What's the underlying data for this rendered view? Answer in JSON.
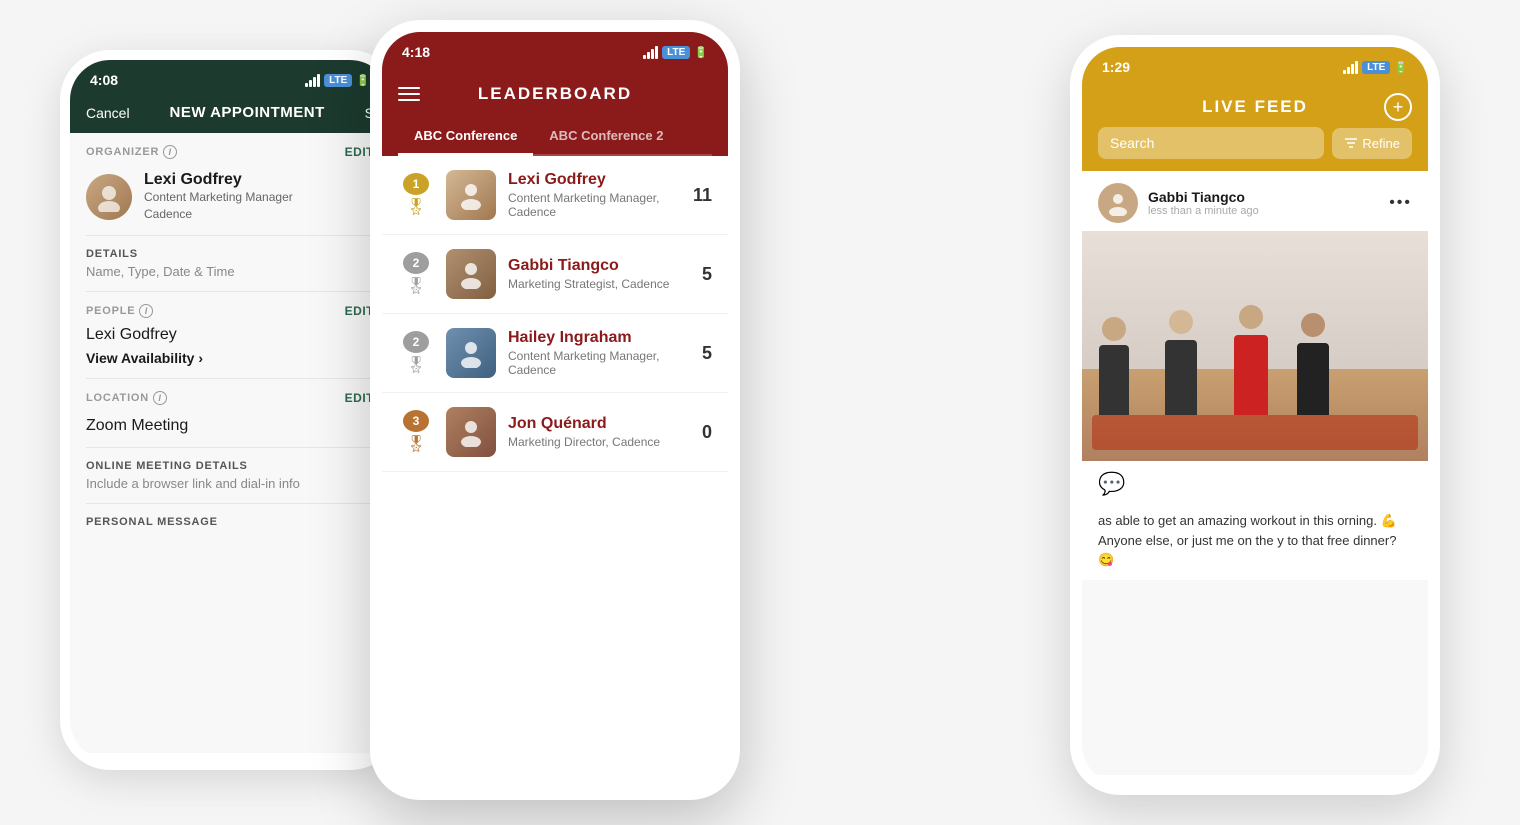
{
  "scene": {
    "background": "#f0f0f0"
  },
  "left_phone": {
    "status_bar": {
      "time": "4:08",
      "signal": "signal",
      "lte": "LTE",
      "battery": "🔋"
    },
    "header": {
      "cancel": "Cancel",
      "title": "NEW APPOINTMENT",
      "save": "S"
    },
    "organizer_section": {
      "label": "ORGANIZER",
      "edit": "EDIT",
      "name": "Lexi Godfrey",
      "title": "Content Marketing Manager",
      "company": "Cadence"
    },
    "details_section": {
      "label": "DETAILS",
      "subtitle": "Name, Type, Date & Time"
    },
    "people_section": {
      "label": "PEOPLE",
      "info": "ⓘ",
      "edit": "EDIT",
      "name": "Lexi Godfrey",
      "view_availability": "View Availability",
      "chevron": "›"
    },
    "location_section": {
      "label": "LOCATION",
      "info": "ⓘ",
      "edit": "EDIT",
      "value": "Zoom Meeting"
    },
    "online_meeting": {
      "label": "ONLINE MEETING DETAILS",
      "subtitle": "Include a browser link and dial-in info"
    },
    "personal_message": {
      "label": "PERSONAL MESSAGE"
    }
  },
  "center_phone": {
    "status_bar": {
      "time": "4:18",
      "lte": "LTE",
      "battery": "🔋"
    },
    "header": {
      "title": "LEADERBOARD"
    },
    "tabs": [
      {
        "label": "ABC Conference",
        "active": true
      },
      {
        "label": "ABC Conference 2",
        "active": false
      }
    ],
    "leaderboard": [
      {
        "rank": 1,
        "name": "Lexi Godfrey",
        "role": "Content Marketing Manager, Cadence",
        "score": 11,
        "avatar_color": "#c8a882",
        "avatar_emoji": "👤"
      },
      {
        "rank": 2,
        "name": "Gabbi Tiangco",
        "role": "Marketing Strategist, Cadence",
        "score": 5,
        "avatar_color": "#a07850",
        "avatar_emoji": "👤"
      },
      {
        "rank": 2,
        "name": "Hailey Ingraham",
        "role": "Content Marketing Manager, Cadence",
        "score": 5,
        "avatar_color": "#6090b0",
        "avatar_emoji": "👤"
      },
      {
        "rank": 3,
        "name": "Jon Quénard",
        "role": "Marketing Director, Cadence",
        "score": 0,
        "avatar_color": "#a06040",
        "avatar_emoji": "👤"
      }
    ]
  },
  "right_phone": {
    "status_bar": {
      "time": "1:29",
      "lte": "LTE",
      "battery": "🔋"
    },
    "header": {
      "title": "LIVE FEED",
      "add_btn": "+"
    },
    "search": {
      "placeholder": "Search",
      "refine": "Refine"
    },
    "post": {
      "user_name": "Gabbi Tiangco",
      "time": "less than a minute ago",
      "caption": "as able to get an amazing workout in this orning. 💪 Anyone else, or just me on the y to that free dinner? 😋"
    }
  }
}
